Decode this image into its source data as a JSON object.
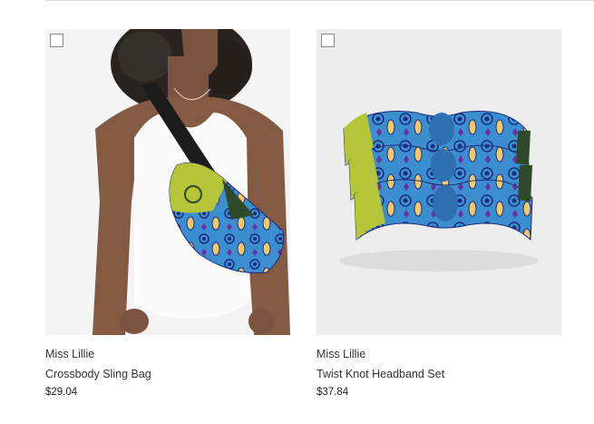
{
  "products": [
    {
      "vendor": "Miss Lillie",
      "title": "Crossbody Sling Bag",
      "price": "$29.04"
    },
    {
      "vendor": "Miss Lillie",
      "title": "Twist Knot Headband Set",
      "price": "$37.84"
    }
  ],
  "colors": {
    "text": "#333333",
    "print_blue": "#3b8fd0",
    "print_lime": "#b6c437",
    "print_navy": "#1e2a7a",
    "print_yellow": "#f1c86a",
    "print_dark_green": "#2e4a2a"
  }
}
